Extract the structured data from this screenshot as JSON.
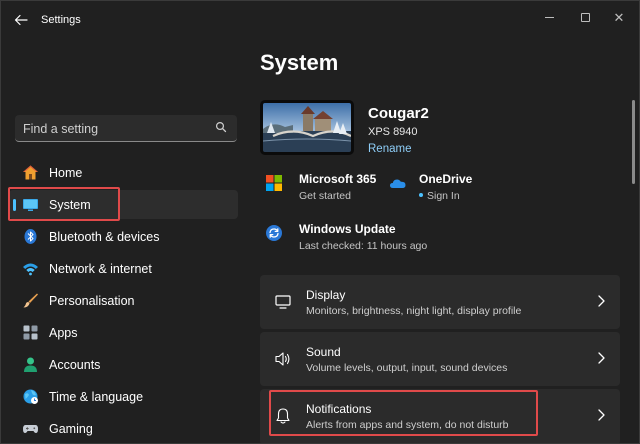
{
  "window": {
    "title": "Settings",
    "back_icon": "arrow-left-icon",
    "controls": [
      "minimize-icon",
      "maximize-icon",
      "close-icon"
    ]
  },
  "search": {
    "placeholder": "Find a setting",
    "value": "",
    "icon": "search-icon"
  },
  "sidebar": {
    "items": [
      {
        "label": "Home",
        "icon": "home-icon",
        "active": false
      },
      {
        "label": "System",
        "icon": "system-icon",
        "active": true
      },
      {
        "label": "Bluetooth & devices",
        "icon": "bluetooth-icon",
        "active": false
      },
      {
        "label": "Network & internet",
        "icon": "wifi-icon",
        "active": false
      },
      {
        "label": "Personalisation",
        "icon": "brush-icon",
        "active": false
      },
      {
        "label": "Apps",
        "icon": "apps-icon",
        "active": false
      },
      {
        "label": "Accounts",
        "icon": "accounts-icon",
        "active": false
      },
      {
        "label": "Time & language",
        "icon": "time-language-icon",
        "active": false
      },
      {
        "label": "Gaming",
        "icon": "gaming-icon",
        "active": false
      }
    ]
  },
  "main": {
    "title": "System",
    "device": {
      "name": "Cougar2",
      "model": "XPS 8940",
      "rename_label": "Rename"
    },
    "status": {
      "microsoft365": {
        "title": "Microsoft 365",
        "subtitle": "Get started"
      },
      "onedrive": {
        "title": "OneDrive",
        "subtitle": "Sign In"
      },
      "windows_update": {
        "title": "Windows Update",
        "subtitle": "Last checked: 11 hours ago"
      }
    },
    "cards": [
      {
        "title": "Display",
        "subtitle": "Monitors, brightness, night light, display profile",
        "icon": "display-icon"
      },
      {
        "title": "Sound",
        "subtitle": "Volume levels, output, input, sound devices",
        "icon": "speaker-icon"
      },
      {
        "title": "Notifications",
        "subtitle": "Alerts from apps and system, do not disturb",
        "icon": "bell-icon"
      }
    ]
  },
  "colors": {
    "background": "#202020",
    "card": "#2b2b2b",
    "accent": "#4cc2ff",
    "link": "#8ecdf7",
    "highlight": "#e04a4a"
  }
}
